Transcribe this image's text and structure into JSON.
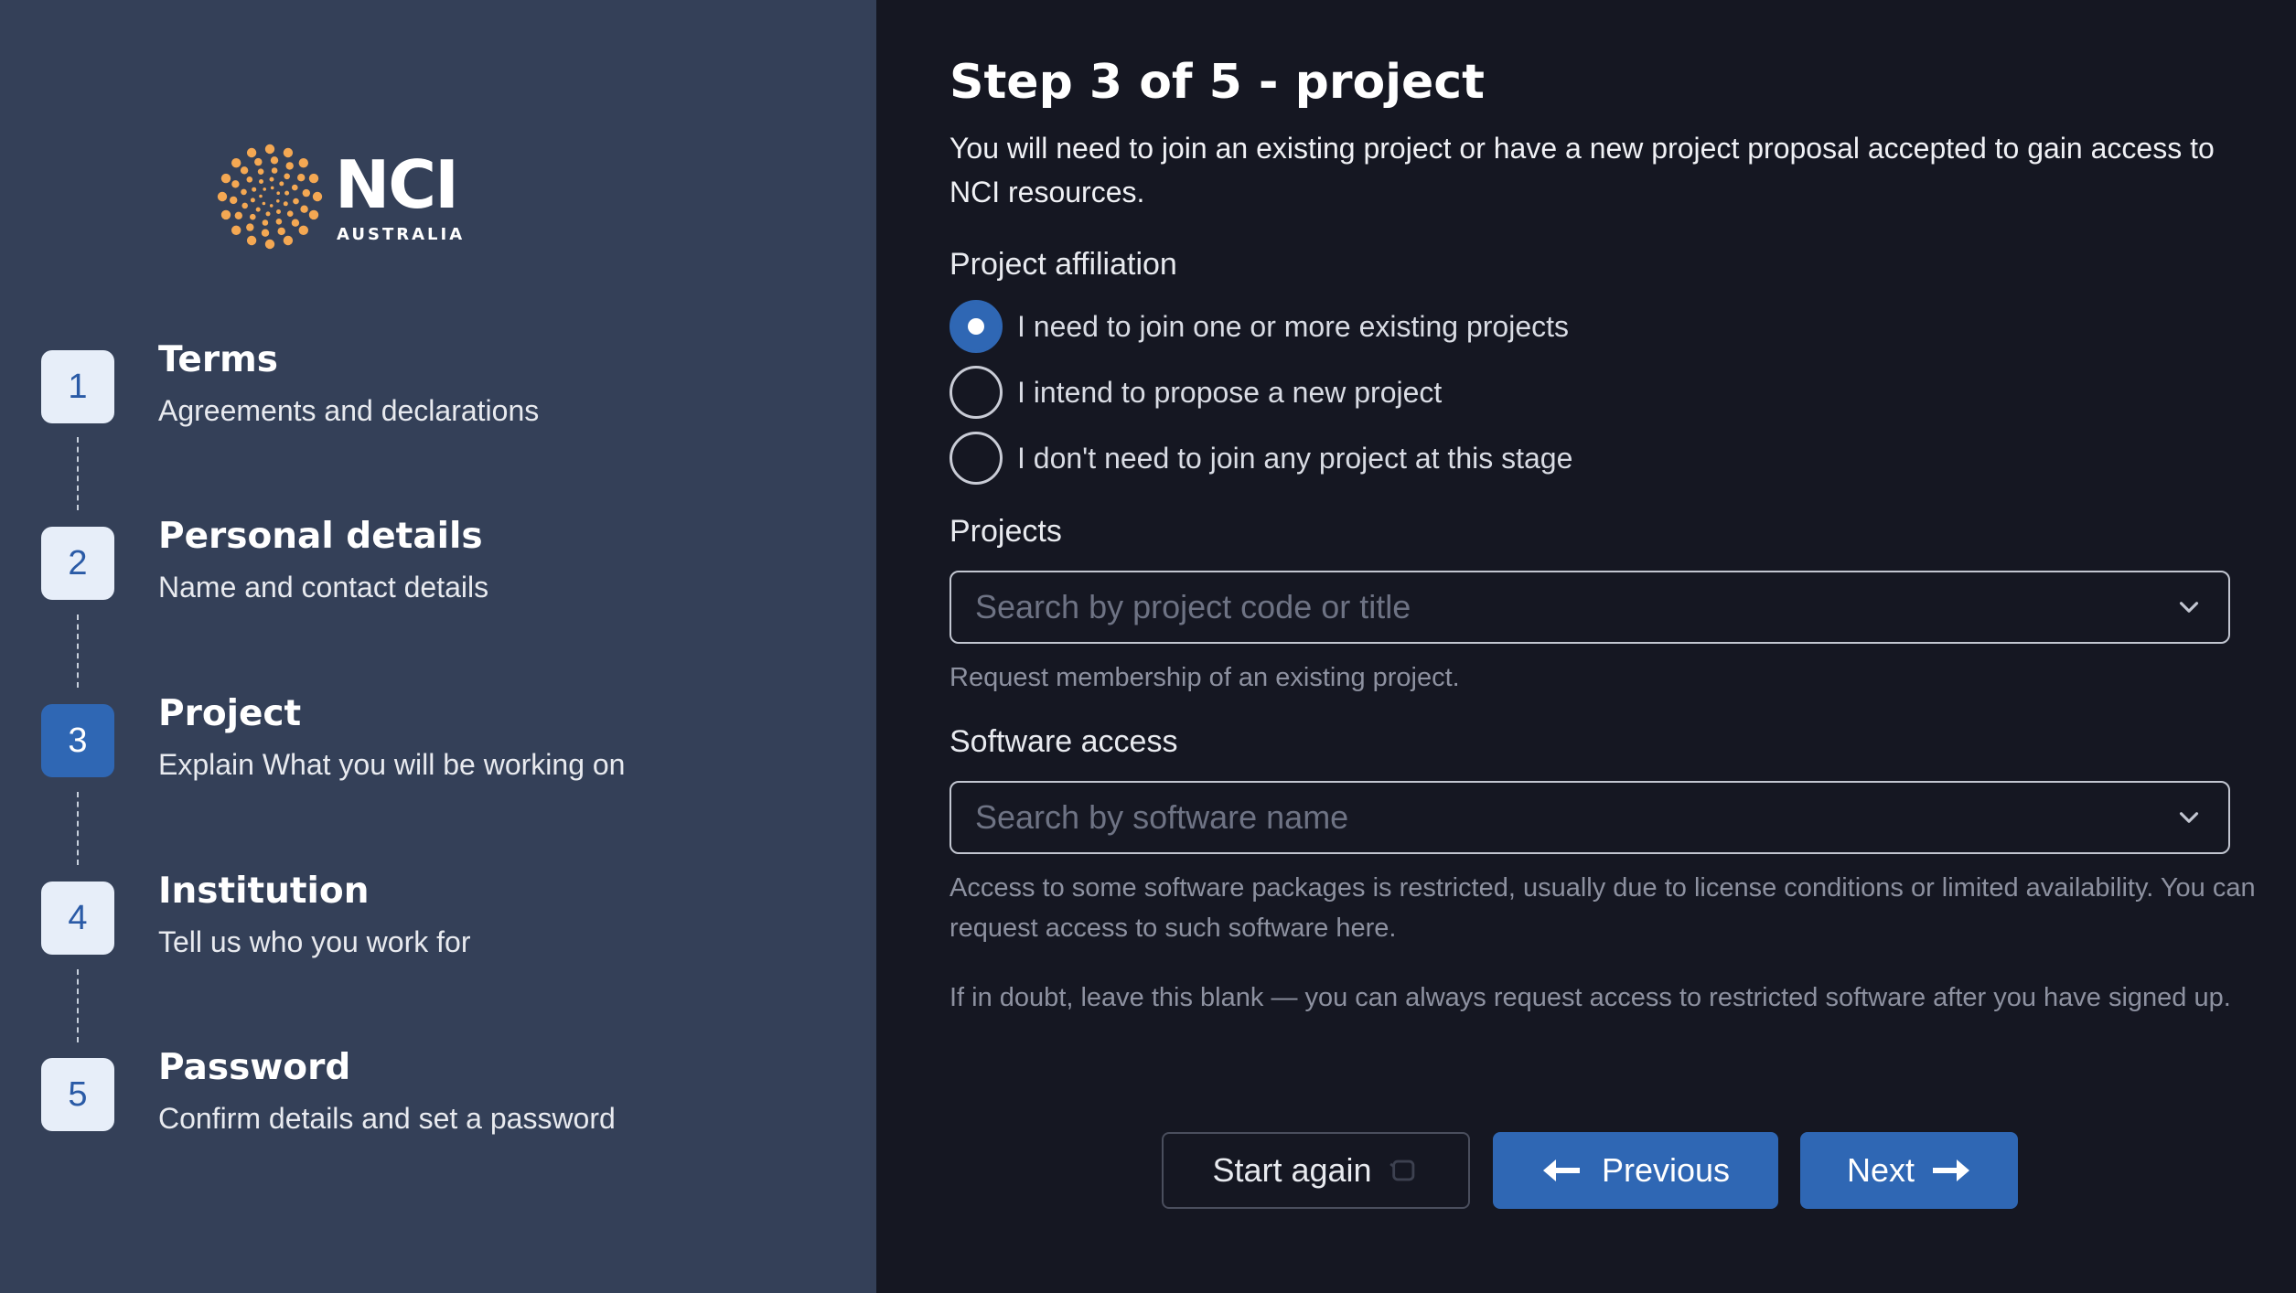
{
  "brand": {
    "logo_text": "NCI",
    "logo_subtext": "AUSTRALIA",
    "accent_color": "#f4a853",
    "primary_color": "#2f67b4"
  },
  "sidebar": {
    "steps": [
      {
        "number": "1",
        "title": "Terms",
        "subtitle": "Agreements and declarations",
        "active": false
      },
      {
        "number": "2",
        "title": "Personal details",
        "subtitle": "Name and contact details",
        "active": false
      },
      {
        "number": "3",
        "title": "Project",
        "subtitle": "Explain What you will be working on",
        "active": true
      },
      {
        "number": "4",
        "title": "Institution",
        "subtitle": "Tell us who you work for",
        "active": false
      },
      {
        "number": "5",
        "title": "Password",
        "subtitle": "Confirm details and set a password",
        "active": false
      }
    ]
  },
  "main": {
    "title": "Step 3 of 5 - project",
    "intro": "You will need to join an existing project or have a new project proposal accepted to gain access to NCI resources.",
    "affiliation": {
      "label": "Project affiliation",
      "options": [
        {
          "label": "I need to join one or more existing projects",
          "checked": true
        },
        {
          "label": "I intend to propose a new project",
          "checked": false
        },
        {
          "label": "I don't need to join any project at this stage",
          "checked": false
        }
      ]
    },
    "projects": {
      "label": "Projects",
      "placeholder": "Search by project code or title",
      "value": "",
      "help": "Request membership of an existing project."
    },
    "software": {
      "label": "Software access",
      "placeholder": "Search by software name",
      "value": "",
      "help1": "Access to some software packages is restricted, usually due to license conditions or limited availability. You can request access to such software here.",
      "help2": "If in doubt, leave this blank — you can always request access to restricted software after you have signed up."
    },
    "buttons": {
      "start_again": "Start again",
      "previous": "Previous",
      "next": "Next"
    }
  }
}
